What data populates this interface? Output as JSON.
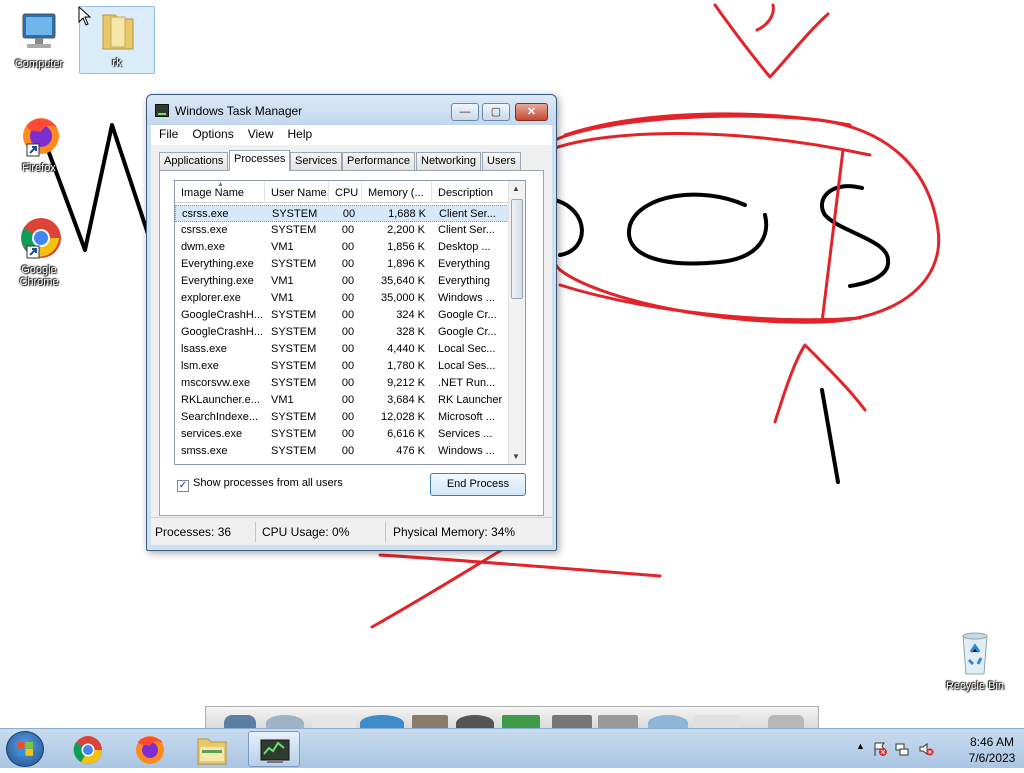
{
  "desktop": {
    "icons": [
      {
        "label": "Computer"
      },
      {
        "label": "rk"
      },
      {
        "label": "Firefox"
      },
      {
        "label": "Google Chrome"
      },
      {
        "label": "Recycle Bin"
      }
    ]
  },
  "window": {
    "title": "Windows Task Manager",
    "controls": {
      "minimize": "—",
      "maximize": "▢",
      "close": "✕"
    },
    "menu": [
      "File",
      "Options",
      "View",
      "Help"
    ],
    "tabs": [
      "Applications",
      "Processes",
      "Services",
      "Performance",
      "Networking",
      "Users"
    ],
    "active_tab": "Processes",
    "columns": [
      "Image Name",
      "User Name",
      "CPU",
      "Memory (...",
      "Description"
    ],
    "processes": [
      {
        "name": "csrss.exe",
        "user": "SYSTEM",
        "cpu": "00",
        "mem": "1,688 K",
        "desc": "Client Ser..."
      },
      {
        "name": "csrss.exe",
        "user": "SYSTEM",
        "cpu": "00",
        "mem": "2,200 K",
        "desc": "Client Ser..."
      },
      {
        "name": "dwm.exe",
        "user": "VM1",
        "cpu": "00",
        "mem": "1,856 K",
        "desc": "Desktop ..."
      },
      {
        "name": "Everything.exe",
        "user": "SYSTEM",
        "cpu": "00",
        "mem": "1,896 K",
        "desc": "Everything"
      },
      {
        "name": "Everything.exe",
        "user": "VM1",
        "cpu": "00",
        "mem": "35,640 K",
        "desc": "Everything"
      },
      {
        "name": "explorer.exe",
        "user": "VM1",
        "cpu": "00",
        "mem": "35,000 K",
        "desc": "Windows ..."
      },
      {
        "name": "GoogleCrashH...",
        "user": "SYSTEM",
        "cpu": "00",
        "mem": "324 K",
        "desc": "Google Cr..."
      },
      {
        "name": "GoogleCrashH...",
        "user": "SYSTEM",
        "cpu": "00",
        "mem": "328 K",
        "desc": "Google Cr..."
      },
      {
        "name": "lsass.exe",
        "user": "SYSTEM",
        "cpu": "00",
        "mem": "4,440 K",
        "desc": "Local Sec..."
      },
      {
        "name": "lsm.exe",
        "user": "SYSTEM",
        "cpu": "00",
        "mem": "1,780 K",
        "desc": "Local Ses..."
      },
      {
        "name": "mscorsvw.exe",
        "user": "SYSTEM",
        "cpu": "00",
        "mem": "9,212 K",
        "desc": ".NET Run..."
      },
      {
        "name": "RKLauncher.e...",
        "user": "VM1",
        "cpu": "00",
        "mem": "3,684 K",
        "desc": "RK Launcher"
      },
      {
        "name": "SearchIndexe...",
        "user": "SYSTEM",
        "cpu": "00",
        "mem": "12,028 K",
        "desc": "Microsoft ..."
      },
      {
        "name": "services.exe",
        "user": "SYSTEM",
        "cpu": "00",
        "mem": "6,616 K",
        "desc": "Services ..."
      },
      {
        "name": "smss.exe",
        "user": "SYSTEM",
        "cpu": "00",
        "mem": "476 K",
        "desc": "Windows ..."
      }
    ],
    "show_all_label": "Show processes from all users",
    "show_all_checked": true,
    "end_process_label": "End Process",
    "status": {
      "processes": "Processes: 36",
      "cpu": "CPU Usage: 0%",
      "memory": "Physical Memory: 34%"
    }
  },
  "taskbar": {
    "apps": [
      "Google Chrome",
      "Firefox",
      "Windows Explorer",
      "Windows Task Manager"
    ],
    "active_app": "Windows Task Manager",
    "tray_icons": [
      "show-hidden-icons",
      "action-center-flag-icon",
      "network-icon",
      "volume-muted-icon"
    ],
    "time": "8:46 AM",
    "date": "7/6/2023"
  }
}
